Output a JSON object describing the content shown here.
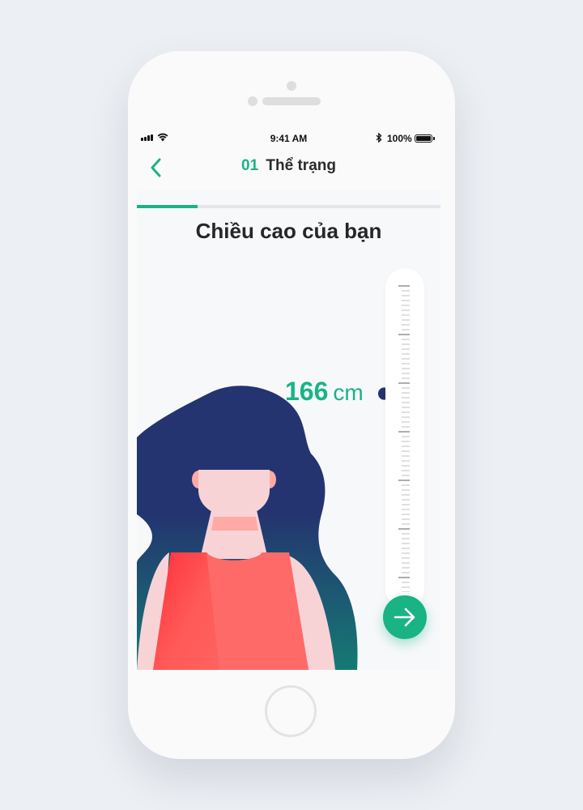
{
  "status_bar": {
    "time": "9:41 AM",
    "battery": "100%"
  },
  "nav": {
    "step": "01",
    "title": "Thể trạng",
    "progress_fraction": 0.2
  },
  "heading": "Chiều cao của bạn",
  "height_picker": {
    "value": "166",
    "unit": "cm"
  },
  "colors": {
    "accent": "#1ab385",
    "hair": "#243470",
    "shirt": "#fd6a68"
  },
  "icons": {
    "back": "chevron-left-icon",
    "next": "arrow-right-icon",
    "pointer": "pointer-drop-icon"
  }
}
